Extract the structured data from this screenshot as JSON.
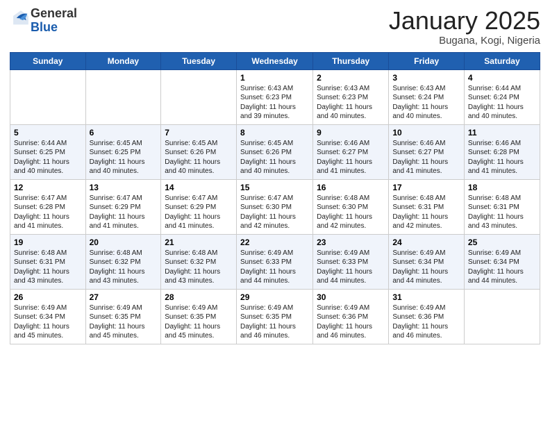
{
  "header": {
    "logo": {
      "general": "General",
      "blue": "Blue"
    },
    "title": "January 2025",
    "location": "Bugana, Kogi, Nigeria"
  },
  "calendar": {
    "days_of_week": [
      "Sunday",
      "Monday",
      "Tuesday",
      "Wednesday",
      "Thursday",
      "Friday",
      "Saturday"
    ],
    "weeks": [
      [
        {
          "day": "",
          "info": ""
        },
        {
          "day": "",
          "info": ""
        },
        {
          "day": "",
          "info": ""
        },
        {
          "day": "1",
          "info": "Sunrise: 6:43 AM\nSunset: 6:23 PM\nDaylight: 11 hours and 39 minutes."
        },
        {
          "day": "2",
          "info": "Sunrise: 6:43 AM\nSunset: 6:23 PM\nDaylight: 11 hours and 40 minutes."
        },
        {
          "day": "3",
          "info": "Sunrise: 6:43 AM\nSunset: 6:24 PM\nDaylight: 11 hours and 40 minutes."
        },
        {
          "day": "4",
          "info": "Sunrise: 6:44 AM\nSunset: 6:24 PM\nDaylight: 11 hours and 40 minutes."
        }
      ],
      [
        {
          "day": "5",
          "info": "Sunrise: 6:44 AM\nSunset: 6:25 PM\nDaylight: 11 hours and 40 minutes."
        },
        {
          "day": "6",
          "info": "Sunrise: 6:45 AM\nSunset: 6:25 PM\nDaylight: 11 hours and 40 minutes."
        },
        {
          "day": "7",
          "info": "Sunrise: 6:45 AM\nSunset: 6:26 PM\nDaylight: 11 hours and 40 minutes."
        },
        {
          "day": "8",
          "info": "Sunrise: 6:45 AM\nSunset: 6:26 PM\nDaylight: 11 hours and 40 minutes."
        },
        {
          "day": "9",
          "info": "Sunrise: 6:46 AM\nSunset: 6:27 PM\nDaylight: 11 hours and 41 minutes."
        },
        {
          "day": "10",
          "info": "Sunrise: 6:46 AM\nSunset: 6:27 PM\nDaylight: 11 hours and 41 minutes."
        },
        {
          "day": "11",
          "info": "Sunrise: 6:46 AM\nSunset: 6:28 PM\nDaylight: 11 hours and 41 minutes."
        }
      ],
      [
        {
          "day": "12",
          "info": "Sunrise: 6:47 AM\nSunset: 6:28 PM\nDaylight: 11 hours and 41 minutes."
        },
        {
          "day": "13",
          "info": "Sunrise: 6:47 AM\nSunset: 6:29 PM\nDaylight: 11 hours and 41 minutes."
        },
        {
          "day": "14",
          "info": "Sunrise: 6:47 AM\nSunset: 6:29 PM\nDaylight: 11 hours and 41 minutes."
        },
        {
          "day": "15",
          "info": "Sunrise: 6:47 AM\nSunset: 6:30 PM\nDaylight: 11 hours and 42 minutes."
        },
        {
          "day": "16",
          "info": "Sunrise: 6:48 AM\nSunset: 6:30 PM\nDaylight: 11 hours and 42 minutes."
        },
        {
          "day": "17",
          "info": "Sunrise: 6:48 AM\nSunset: 6:31 PM\nDaylight: 11 hours and 42 minutes."
        },
        {
          "day": "18",
          "info": "Sunrise: 6:48 AM\nSunset: 6:31 PM\nDaylight: 11 hours and 43 minutes."
        }
      ],
      [
        {
          "day": "19",
          "info": "Sunrise: 6:48 AM\nSunset: 6:31 PM\nDaylight: 11 hours and 43 minutes."
        },
        {
          "day": "20",
          "info": "Sunrise: 6:48 AM\nSunset: 6:32 PM\nDaylight: 11 hours and 43 minutes."
        },
        {
          "day": "21",
          "info": "Sunrise: 6:48 AM\nSunset: 6:32 PM\nDaylight: 11 hours and 43 minutes."
        },
        {
          "day": "22",
          "info": "Sunrise: 6:49 AM\nSunset: 6:33 PM\nDaylight: 11 hours and 44 minutes."
        },
        {
          "day": "23",
          "info": "Sunrise: 6:49 AM\nSunset: 6:33 PM\nDaylight: 11 hours and 44 minutes."
        },
        {
          "day": "24",
          "info": "Sunrise: 6:49 AM\nSunset: 6:34 PM\nDaylight: 11 hours and 44 minutes."
        },
        {
          "day": "25",
          "info": "Sunrise: 6:49 AM\nSunset: 6:34 PM\nDaylight: 11 hours and 44 minutes."
        }
      ],
      [
        {
          "day": "26",
          "info": "Sunrise: 6:49 AM\nSunset: 6:34 PM\nDaylight: 11 hours and 45 minutes."
        },
        {
          "day": "27",
          "info": "Sunrise: 6:49 AM\nSunset: 6:35 PM\nDaylight: 11 hours and 45 minutes."
        },
        {
          "day": "28",
          "info": "Sunrise: 6:49 AM\nSunset: 6:35 PM\nDaylight: 11 hours and 45 minutes."
        },
        {
          "day": "29",
          "info": "Sunrise: 6:49 AM\nSunset: 6:35 PM\nDaylight: 11 hours and 46 minutes."
        },
        {
          "day": "30",
          "info": "Sunrise: 6:49 AM\nSunset: 6:36 PM\nDaylight: 11 hours and 46 minutes."
        },
        {
          "day": "31",
          "info": "Sunrise: 6:49 AM\nSunset: 6:36 PM\nDaylight: 11 hours and 46 minutes."
        },
        {
          "day": "",
          "info": ""
        }
      ]
    ]
  }
}
